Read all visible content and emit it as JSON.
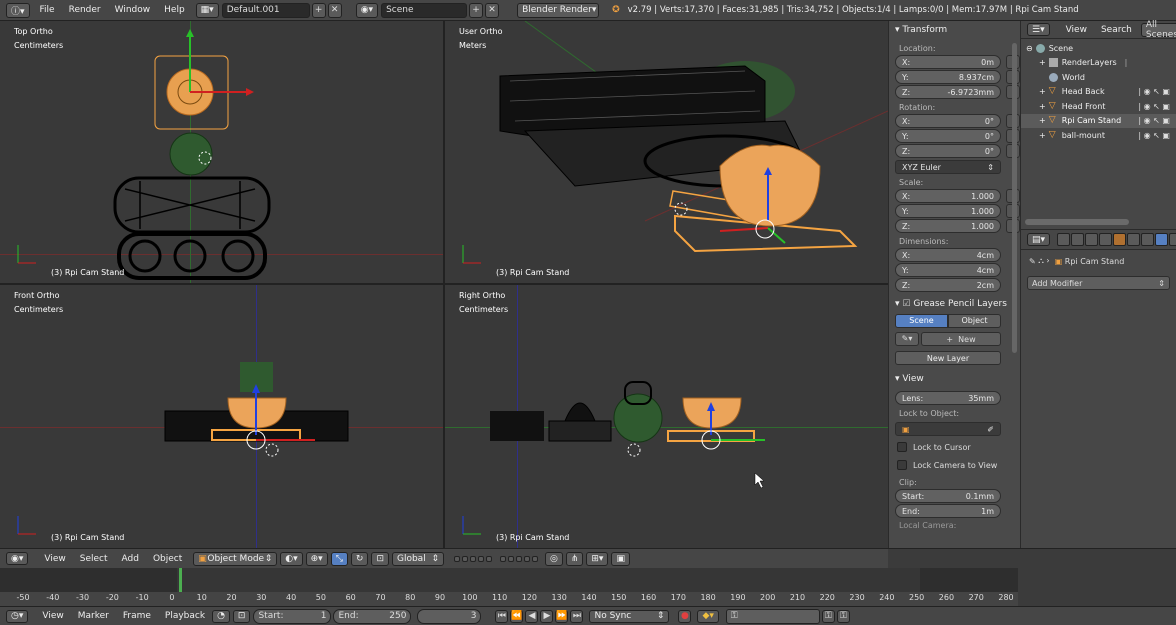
{
  "topbar": {
    "menus": [
      "File",
      "Render",
      "Window",
      "Help"
    ],
    "screen_layout": "Default.001",
    "scene": "Scene",
    "engine": "Blender Render",
    "stats": "v2.79 | Verts:17,370 | Faces:31,985 | Tris:34,752 | Objects:1/4 | Lamps:0/0 | Mem:17.97M | Rpi Cam Stand"
  },
  "viewports": {
    "top_left": {
      "view": "Top Ortho",
      "units": "Centimeters",
      "object": "(3) Rpi Cam Stand"
    },
    "top_right": {
      "view": "User Ortho",
      "units": "Meters",
      "object": "(3) Rpi Cam Stand"
    },
    "bottom_left": {
      "view": "Front Ortho",
      "units": "Centimeters",
      "object": "(3) Rpi Cam Stand"
    },
    "bottom_right": {
      "view": "Right Ortho",
      "units": "Centimeters",
      "object": "(3) Rpi Cam Stand"
    }
  },
  "npanel": {
    "transform_title": "Transform",
    "location_label": "Location:",
    "location": {
      "x": "0m",
      "y": "8.937cm",
      "z": "-6.9723mm"
    },
    "rotation_label": "Rotation:",
    "rotation": {
      "x": "0°",
      "y": "0°",
      "z": "0°"
    },
    "rotation_mode": "XYZ Euler",
    "scale_label": "Scale:",
    "scale": {
      "x": "1.000",
      "y": "1.000",
      "z": "1.000"
    },
    "dimensions_label": "Dimensions:",
    "dimensions": {
      "x": "4cm",
      "y": "4cm",
      "z": "2cm"
    },
    "axis_x": "X:",
    "axis_y": "Y:",
    "axis_z": "Z:",
    "grease_title": "Grease Pencil Layers",
    "grease_tab_scene": "Scene",
    "grease_tab_object": "Object",
    "grease_new": "New",
    "grease_new_layer": "New Layer",
    "view_title": "View",
    "lens_label": "Lens:",
    "lens": "35mm",
    "lock_object_label": "Lock to Object:",
    "lock_cursor": "Lock to Cursor",
    "lock_camera": "Lock Camera to View",
    "clip_label": "Clip:",
    "clip_start_label": "Start:",
    "clip_start": "0.1mm",
    "clip_end_label": "End:",
    "clip_end": "1m",
    "local_camera_label": "Local Camera:"
  },
  "outliner": {
    "menu_view": "View",
    "menu_search": "Search",
    "display": "All Scenes",
    "rows": [
      "Scene",
      "RenderLayers",
      "World",
      "Head Back",
      "Head Front",
      "Rpi Cam Stand",
      "ball-mount"
    ]
  },
  "properties": {
    "object_name": "Rpi Cam Stand",
    "add_modifier": "Add Modifier"
  },
  "view3d_header": {
    "menus": [
      "View",
      "Select",
      "Add",
      "Object"
    ],
    "mode": "Object Mode",
    "orientation": "Global"
  },
  "timeline": {
    "ticks": [
      -50,
      -40,
      -30,
      -20,
      -10,
      0,
      10,
      20,
      30,
      40,
      50,
      60,
      70,
      80,
      90,
      100,
      110,
      120,
      130,
      140,
      150,
      160,
      170,
      180,
      190,
      200,
      210,
      220,
      230,
      240,
      250,
      260,
      270,
      280
    ],
    "current_frame": 3,
    "menus": [
      "View",
      "Marker",
      "Frame",
      "Playback"
    ],
    "start_label": "Start:",
    "start": "1",
    "end_label": "End:",
    "end": "250",
    "frame": "3",
    "sync": "No Sync"
  },
  "colors": {
    "selected": "#f5a442",
    "wire": "#000000",
    "green_obj": "#2f6a2f",
    "accent_blue": "#5680c2"
  }
}
